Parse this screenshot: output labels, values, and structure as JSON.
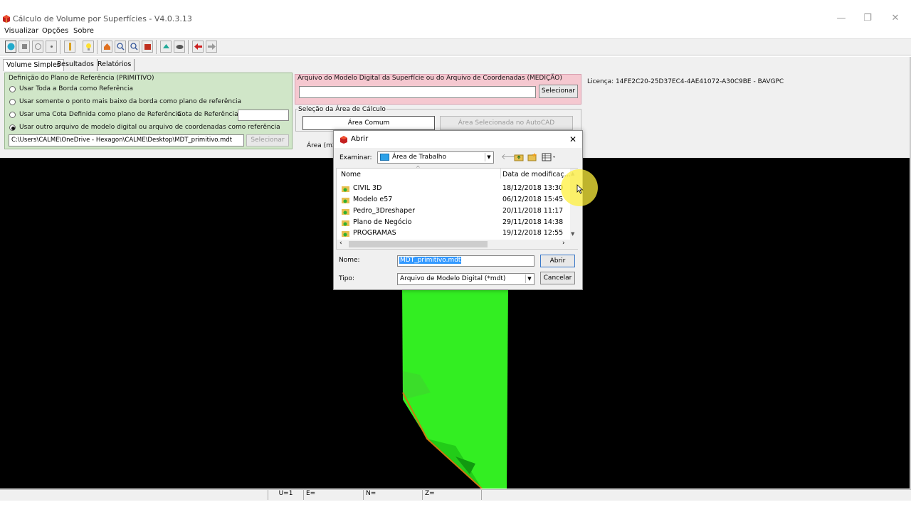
{
  "window": {
    "title": "Cálculo de Volume por Superfícies - V4.0.3.13",
    "minimize": "—",
    "restore": "❐",
    "close": "✕"
  },
  "menu": [
    "Visualizar",
    "Opções",
    "Sobre"
  ],
  "tabs": [
    "Volume Simples",
    "Resultados",
    "Relatórios"
  ],
  "primitivo": {
    "legend": "Definição do Plano de Referência (PRIMITIVO)",
    "options": [
      "Usar Toda a Borda como Referência",
      "Usar somente o ponto mais baixo da borda como plano de referência",
      "Usar uma Cota Definida como plano de Referência",
      "Usar outro arquivo de modelo digital ou arquivo de coordenadas como referência"
    ],
    "selected_option": 3,
    "cota_label": "Cota de Referência",
    "cota_value": "",
    "path_value": "C:\\Users\\CALME\\OneDrive - Hexagon\\CALME\\Desktop\\MDT_primitivo.mdt",
    "select_button": "Selecionar"
  },
  "medicao": {
    "legend": "Arquivo do Modelo Digital da Superfície ou do Arquivo de Coordenadas (MEDIÇÃO)",
    "path_value": "",
    "select_button": "Selecionar"
  },
  "area_calc": {
    "legend": "Seleção da Área de Cálculo",
    "area_comum": "Área Comum",
    "area_autocad": "Área Selecionada no AutoCAD",
    "area_label": "Área (m2"
  },
  "license": "Licença: 14FE2C20-25D37EC4-4AE41072-A30C9BE - BAVGPC",
  "statusbar": {
    "u": "U=1",
    "e": "E=",
    "n": "N=",
    "z": "Z="
  },
  "dialog": {
    "title": "Abrir",
    "close": "✕",
    "examinar_label": "Examinar:",
    "location": "Área de Trabalho",
    "col_name": "Nome",
    "col_date": "Data de modificaç...",
    "files": [
      {
        "name": "CIVIL 3D",
        "date": "18/12/2018 13:30"
      },
      {
        "name": "Modelo e57",
        "date": "06/12/2018 15:45"
      },
      {
        "name": "Pedro_3Dreshaper",
        "date": "20/11/2018 11:17"
      },
      {
        "name": "Plano de Negócio",
        "date": "29/11/2018 14:38"
      },
      {
        "name": "PROGRAMAS",
        "date": "19/12/2018 12:55"
      }
    ],
    "nome_label": "Nome:",
    "nome_value": "MDT_primitivo.mdt",
    "tipo_label": "Tipo:",
    "tipo_value": "Arquivo de Modelo Digital (*mdt)",
    "open_button": "Abrir",
    "cancel_button": "Cancelar"
  },
  "colors": {
    "green_panel": "#d0e6c8",
    "pink_panel": "#f5c8d0",
    "surface": "#33ee22",
    "canvas": "#000000",
    "selection": "#3399ff"
  }
}
